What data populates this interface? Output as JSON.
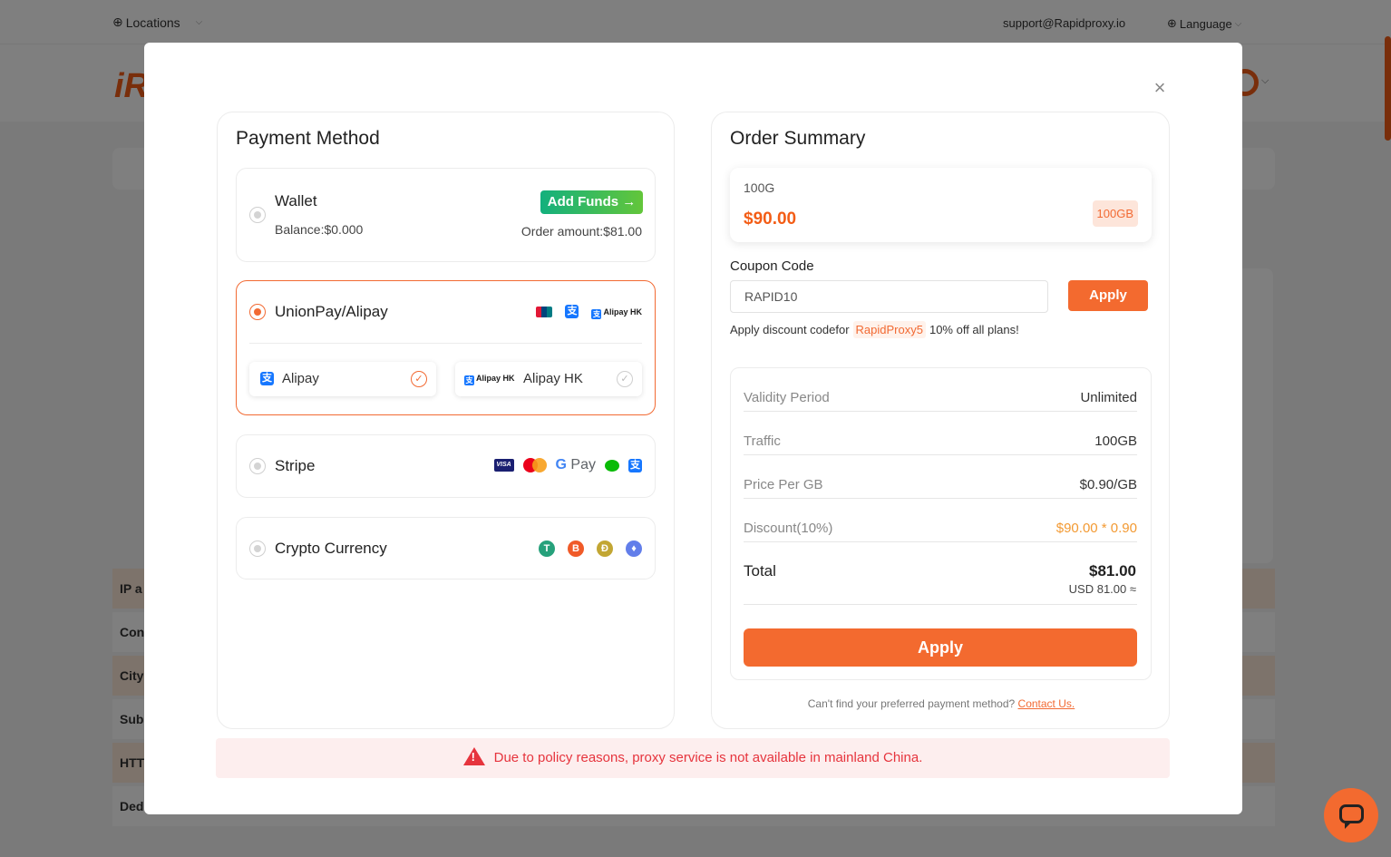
{
  "background": {
    "locations_label": "Locations",
    "support_email": "support@Rapidproxy.io",
    "language_label": "Language",
    "logo_text": "iR",
    "table_rows": [
      "IP a",
      "Con",
      "City",
      "Sub",
      "HTT",
      "Ded"
    ]
  },
  "modal": {
    "payment_method": {
      "title": "Payment Method",
      "wallet": {
        "label": "Wallet",
        "add_funds_label": "Add Funds →",
        "balance": "Balance:$0.000",
        "order_amount": "Order amount:$81.00"
      },
      "unionpay_alipay": {
        "label": "UnionPay/Alipay",
        "alipayhk_logo_text": "Alipay HK",
        "options": [
          {
            "label": "Alipay",
            "selected": true
          },
          {
            "label": "Alipay HK",
            "selected": false
          }
        ]
      },
      "stripe": {
        "label": "Stripe",
        "visa_text": "VISA",
        "gpay_text": "Pay"
      },
      "crypto": {
        "label": "Crypto Currency",
        "coins": [
          {
            "symbol": "T",
            "color": "#26a17b"
          },
          {
            "symbol": "B",
            "color": "#f05a28"
          },
          {
            "symbol": "Ð",
            "color": "#c2a633"
          },
          {
            "symbol": "♦",
            "color": "#627eea"
          }
        ]
      }
    },
    "order_summary": {
      "title": "Order Summary",
      "product": {
        "name": "100G",
        "price": "$90.00",
        "tag": "100GB"
      },
      "coupon": {
        "label": "Coupon Code",
        "value": "RAPID10",
        "apply_label": "Apply",
        "note_prefix": "Apply discount codefor",
        "note_code": "RapidProxy5",
        "note_suffix": "10% off all plans!"
      },
      "rows": [
        {
          "key": "Validity Period",
          "value": "Unlimited"
        },
        {
          "key": "Traffic",
          "value": "100GB"
        },
        {
          "key": "Price Per GB",
          "value": "$0.90/GB"
        },
        {
          "key": "Discount(10%)",
          "value": "$90.00 * 0.90"
        }
      ],
      "total_label": "Total",
      "total_value": "$81.00",
      "total_usd": "USD 81.00 ≈",
      "apply_label": "Apply",
      "help_text": "Can't find your preferred payment method?",
      "contact_label": "Contact Us."
    },
    "warning_text": "Due to policy reasons, proxy service is not available in mainland China.",
    "close_label": "×"
  },
  "colors": {
    "accent": "#f36a2f",
    "green_start": "#13b07d",
    "warning_red": "#e6343d"
  }
}
